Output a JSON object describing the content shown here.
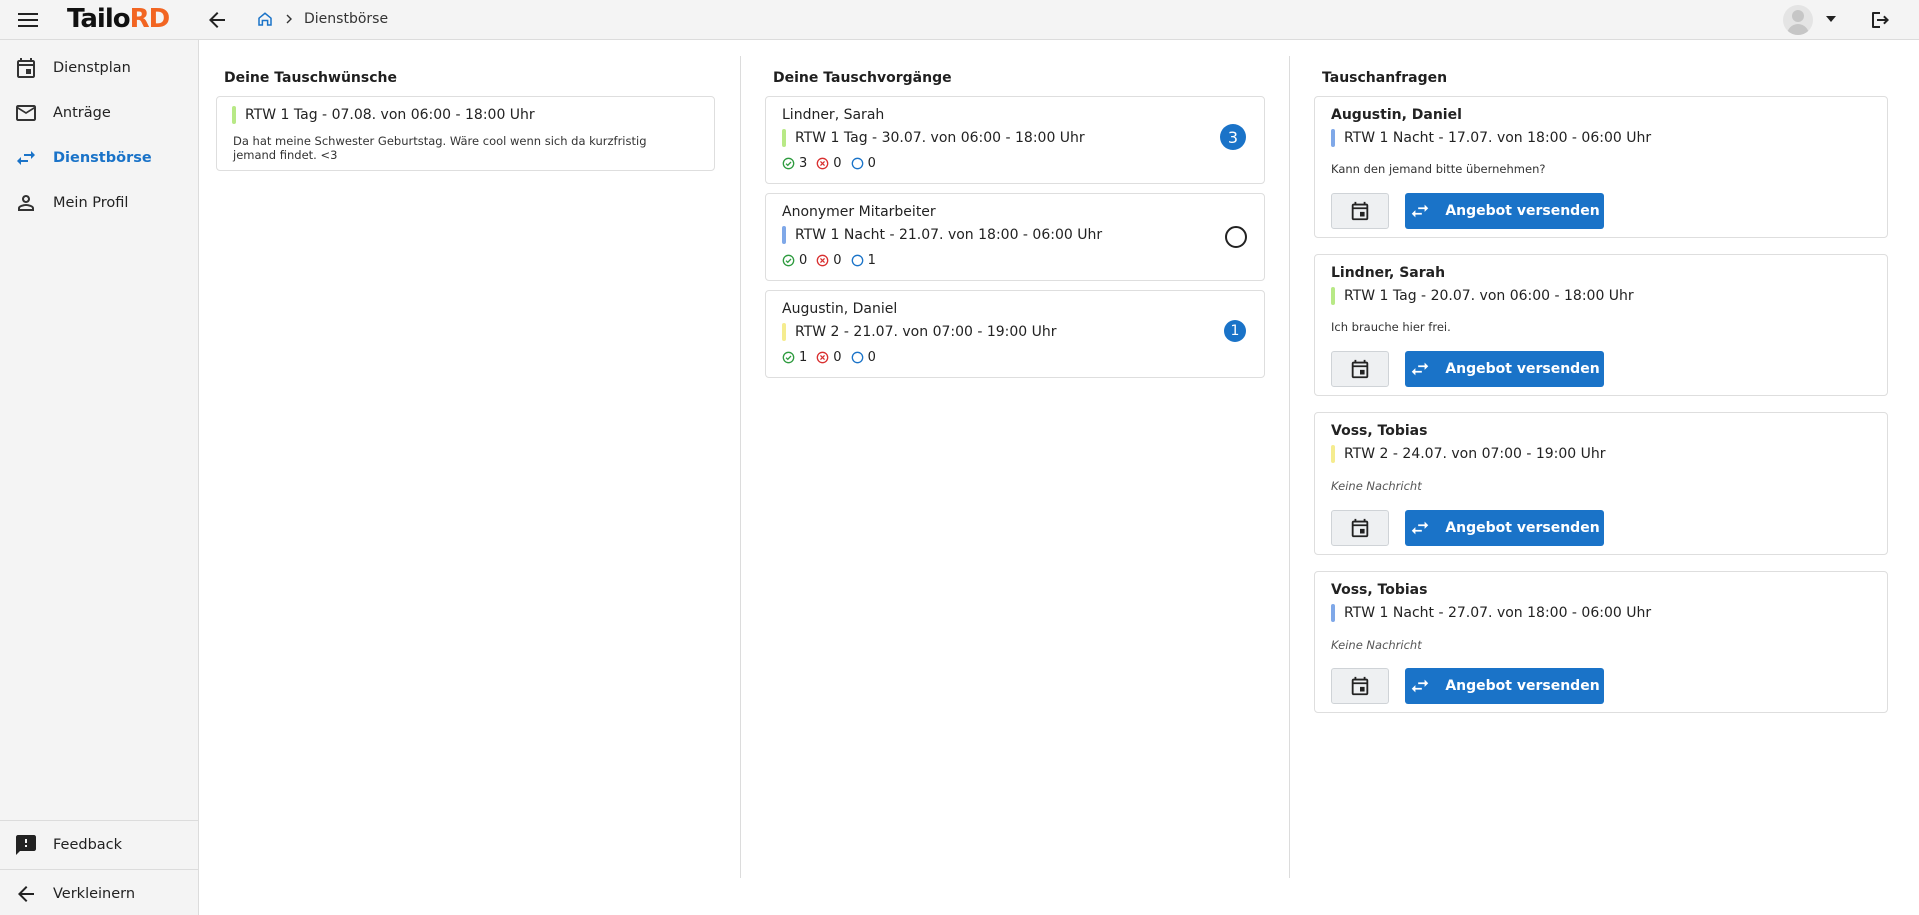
{
  "app": {
    "logo_part1": "Tailo",
    "logo_part2": "RD"
  },
  "breadcrumb": {
    "current": "Dienstbörse"
  },
  "sidebar": {
    "items": [
      {
        "label": "Dienstplan",
        "icon": "calendar-icon"
      },
      {
        "label": "Anträge",
        "icon": "mail-icon"
      },
      {
        "label": "Dienstbörse",
        "icon": "swap-icon",
        "active": true
      },
      {
        "label": "Mein Profil",
        "icon": "person-icon"
      }
    ],
    "feedback": "Feedback",
    "collapse": "Verkleinern"
  },
  "wishes": {
    "title": "Deine Tauschwünsche",
    "items": [
      {
        "shift": "RTW 1 Tag - 07.08. von 06:00 - 18:00 Uhr",
        "color": "#b8e986",
        "message": "Da hat meine Schwester Geburtstag. Wäre cool wenn sich da kurzfristig jemand findet. <3"
      }
    ]
  },
  "processes": {
    "title": "Deine Tauschvorgänge",
    "items": [
      {
        "person": "Lindner, Sarah",
        "shift": "RTW 1 Tag - 30.07. von 06:00 - 18:00 Uhr",
        "color": "#b8e986",
        "accepted": "3",
        "declined": "0",
        "open": "0",
        "badge": "3"
      },
      {
        "person": "Anonymer Mitarbeiter",
        "shift": "RTW 1 Nacht - 21.07. von 18:00 - 06:00 Uhr",
        "color": "#7fa8e8",
        "accepted": "0",
        "declined": "0",
        "open": "1",
        "badge": ""
      },
      {
        "person": "Augustin, Daniel",
        "shift": "RTW 2 - 21.07. von 07:00 - 19:00 Uhr",
        "color": "#f5ec8f",
        "accepted": "1",
        "declined": "0",
        "open": "0",
        "badge": "1"
      }
    ]
  },
  "requests": {
    "title": "Tauschanfragen",
    "offer_label": "Angebot versenden",
    "items": [
      {
        "person": "Augustin, Daniel",
        "shift": "RTW 1 Nacht - 17.07. von 18:00 - 06:00 Uhr",
        "color": "#7fa8e8",
        "message": "Kann den jemand bitte übernehmen?",
        "no_message": false
      },
      {
        "person": "Lindner, Sarah",
        "shift": "RTW 1 Tag - 20.07. von 06:00 - 18:00 Uhr",
        "color": "#b8e986",
        "message": "Ich brauche hier frei.",
        "no_message": false
      },
      {
        "person": "Voss, Tobias",
        "shift": "RTW 2 - 24.07. von 07:00 - 19:00 Uhr",
        "color": "#f5ec8f",
        "message": "Keine Nachricht",
        "no_message": true
      },
      {
        "person": "Voss, Tobias",
        "shift": "RTW 1 Nacht - 27.07. von 18:00 - 06:00 Uhr",
        "color": "#7fa8e8",
        "message": "Keine Nachricht",
        "no_message": true
      }
    ]
  },
  "colors": {
    "accent": "#1a73c8",
    "brand_orange": "#f26522",
    "success": "#2e9b3f",
    "danger": "#d93030"
  }
}
